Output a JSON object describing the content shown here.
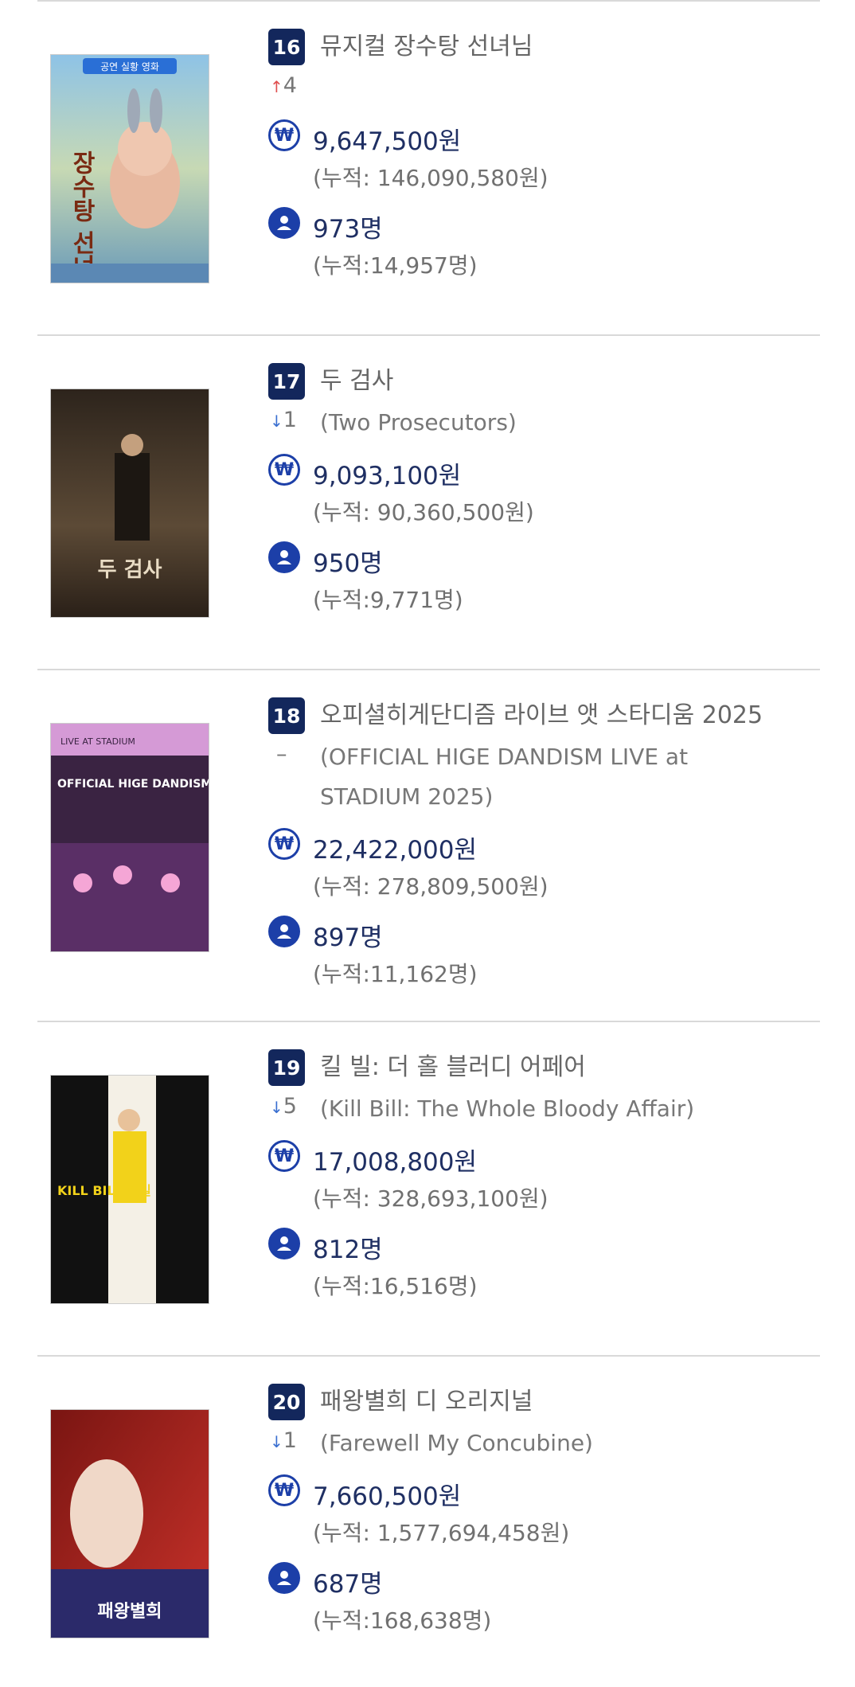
{
  "items": [
    {
      "rank": "16",
      "title": "뮤지컬 장수탕 선녀님",
      "subtitle": "",
      "change_dir": "up",
      "change_value": "4",
      "sales": "9,647,500원",
      "sales_cum": "(누적: 146,090,580원)",
      "audience": "973명",
      "audience_cum": "(누적:14,957명)"
    },
    {
      "rank": "17",
      "title": "두 검사",
      "subtitle": "(Two Prosecutors)",
      "change_dir": "down",
      "change_value": "1",
      "sales": "9,093,100원",
      "sales_cum": "(누적: 90,360,500원)",
      "audience": "950명",
      "audience_cum": "(누적:9,771명)"
    },
    {
      "rank": "18",
      "title": "오피셜히게단디즘 라이브 앳 스타디움 2025",
      "subtitle": "(OFFICIAL HIGE DANDISM LIVE at STADIUM 2025)",
      "change_dir": "same",
      "change_value": "–",
      "sales": "22,422,000원",
      "sales_cum": "(누적: 278,809,500원)",
      "audience": "897명",
      "audience_cum": "(누적:11,162명)"
    },
    {
      "rank": "19",
      "title": "킬 빌: 더 홀 블러디 어페어",
      "subtitle": "(Kill Bill: The Whole Bloody Affair)",
      "change_dir": "down",
      "change_value": "5",
      "sales": "17,008,800원",
      "sales_cum": "(누적: 328,693,100원)",
      "audience": "812명",
      "audience_cum": "(누적:16,516명)"
    },
    {
      "rank": "20",
      "title": "패왕별희 디 오리지널",
      "subtitle": "(Farewell My Concubine)",
      "change_dir": "down",
      "change_value": "1",
      "sales": "7,660,500원",
      "sales_cum": "(누적: 1,577,694,458원)",
      "audience": "687명",
      "audience_cum": "(누적:168,638명)"
    }
  ],
  "posters": [
    {
      "text_top": "공연 실황 영화",
      "text_main": "장수탕 선녀님"
    },
    {
      "text_top": "",
      "text_main": "두 검사"
    },
    {
      "text_top": "LIVE AT STADIUM",
      "text_main": "OFFICIAL HIGE DANDISM"
    },
    {
      "text_top": "",
      "text_main": "KILL BILL 킬빌"
    },
    {
      "text_top": "",
      "text_main": "패왕별희"
    }
  ],
  "icons": {
    "sales": "won-coin-icon",
    "audience": "user-circle-icon"
  },
  "colors": {
    "rank_badge": "#13275c",
    "icon": "#1c3fa8",
    "up": "#e05050",
    "down": "#3a6fd0",
    "value": "#1f2f63"
  }
}
